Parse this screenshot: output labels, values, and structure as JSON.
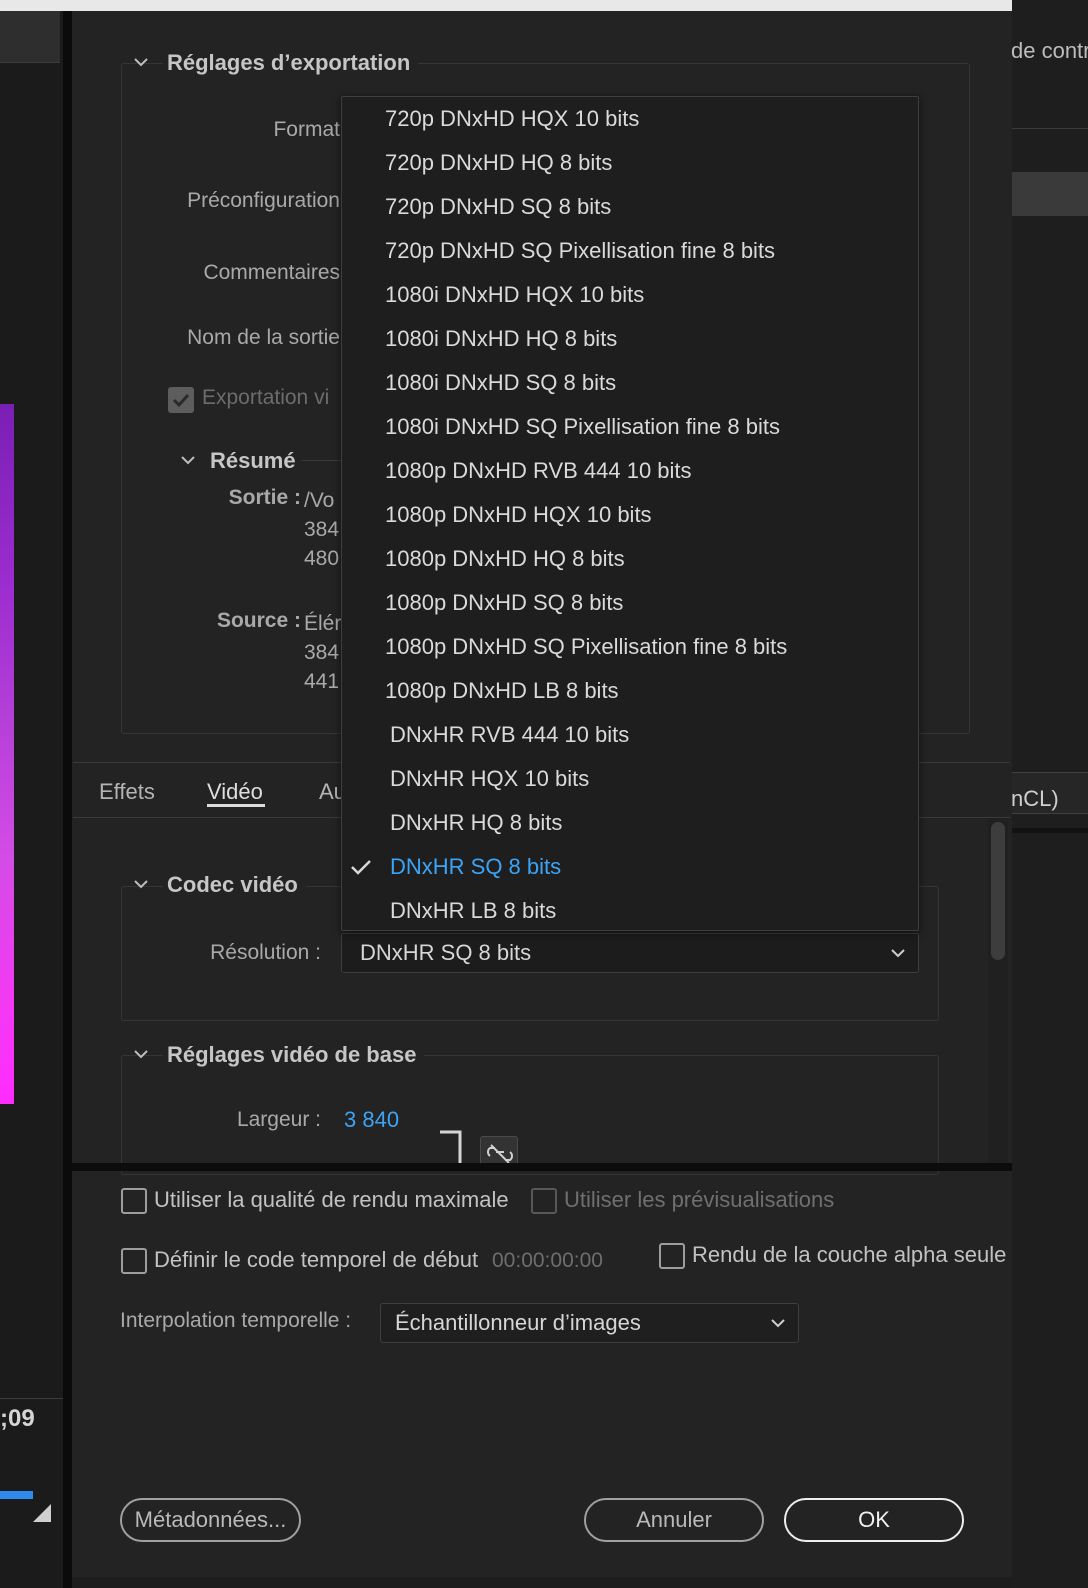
{
  "right_panel": {
    "partial_text_top": "de contr",
    "partial_text_mid": "nCL)"
  },
  "left_panel": {
    "timecode_partial": ";09"
  },
  "export_settings": {
    "section_title": "Réglages d’exportation",
    "format_label": "Format",
    "preset_label": "Préconfiguration",
    "comments_label": "Commentaires",
    "output_name_label": "Nom de la sortie",
    "export_video_label": "Exportation vi",
    "export_video_checked": true,
    "summary": {
      "title": "Résumé",
      "output_label": "Sortie :",
      "output_lines": [
        "/Vo",
        "384",
        "480"
      ],
      "source_label": "Source :",
      "source_lines": [
        "Élér",
        "384",
        "441"
      ]
    }
  },
  "tabs": {
    "items": [
      "Effets",
      "Vidéo",
      "Au"
    ],
    "active": "Vidéo"
  },
  "video_codec": {
    "section_title": "Codec vidéo",
    "resolution_label": "Résolution :",
    "resolution_value": "DNxHR SQ 8 bits"
  },
  "basic_video": {
    "section_title": "Réglages vidéo de base",
    "width_label": "Largeur :",
    "width_value": "3 840",
    "link_icon": "unlink-icon"
  },
  "dropdown": {
    "items": [
      "720p DNxHD HQX 10 bits",
      "720p DNxHD HQ 8 bits",
      "720p DNxHD SQ 8 bits",
      "720p DNxHD SQ Pixellisation fine 8 bits",
      "1080i DNxHD HQX 10 bits",
      "1080i DNxHD HQ 8 bits",
      "1080i DNxHD SQ 8 bits",
      "1080i DNxHD SQ Pixellisation fine 8 bits",
      "1080p DNxHD RVB 444 10 bits",
      "1080p DNxHD HQX 10 bits",
      "1080p DNxHD HQ 8 bits",
      "1080p DNxHD SQ 8 bits",
      "1080p DNxHD SQ Pixellisation fine 8 bits",
      "1080p DNxHD LB 8 bits",
      "DNxHR RVB 444 10 bits",
      "DNxHR HQX 10 bits",
      "DNxHR HQ 8 bits",
      "DNxHR SQ 8 bits",
      "DNxHR LB 8 bits"
    ],
    "selected": "DNxHR SQ 8 bits"
  },
  "bottom_options": {
    "max_render_quality": "Utiliser la qualité de rendu maximale",
    "use_previews": "Utiliser les prévisualisations",
    "set_start_timecode": "Définir le code temporel de début",
    "start_timecode_value": "00:00:00:00",
    "render_alpha_only": "Rendu de la couche alpha seule",
    "time_interpolation_label": "Interpolation temporelle :",
    "time_interpolation_value": "Échantillonneur d’images"
  },
  "buttons": {
    "metadata": "Métadonnées...",
    "cancel": "Annuler",
    "ok": "OK"
  },
  "colors": {
    "accent": "#3da4f5",
    "background": "#232323"
  }
}
